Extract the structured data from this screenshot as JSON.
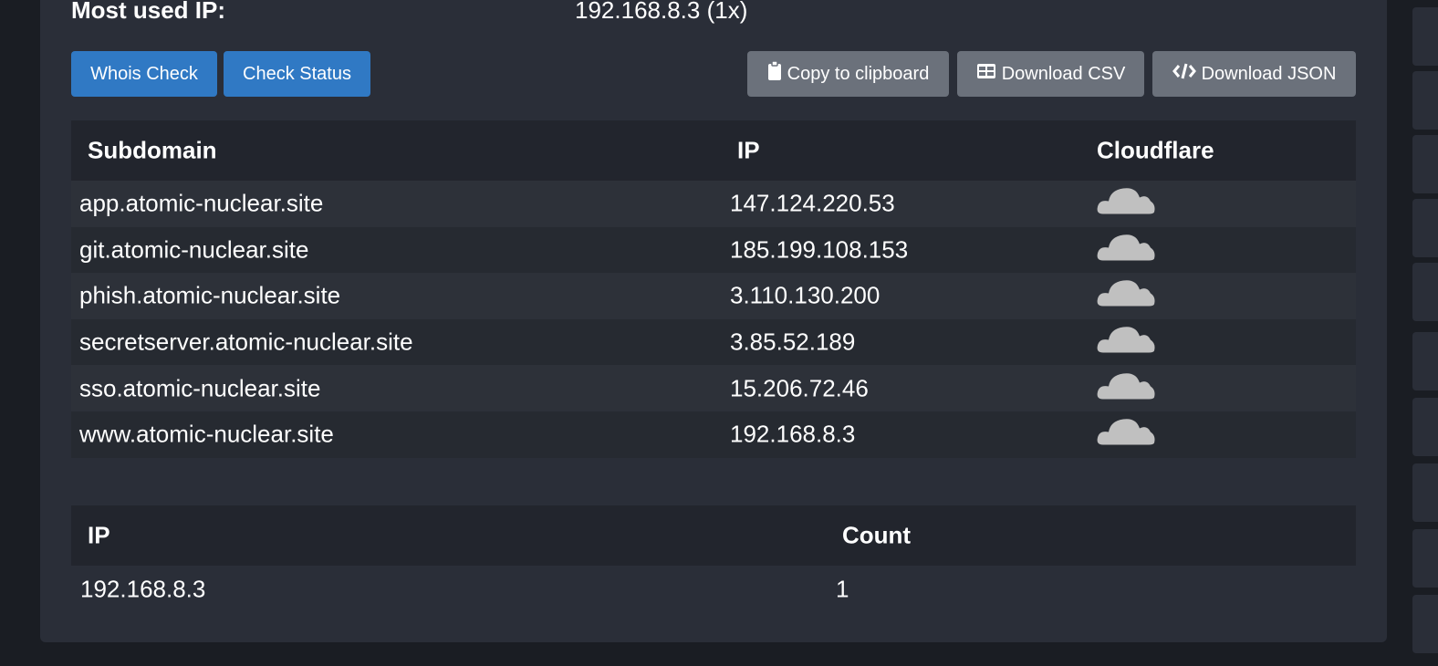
{
  "summary": {
    "label": "Most used IP:",
    "value": "192.168.8.3 (1x)"
  },
  "buttons": {
    "whois": "Whois Check",
    "status": "Check Status",
    "copy": "Copy to clipboard",
    "csv": "Download CSV",
    "json": "Download JSON"
  },
  "subdomain_table": {
    "headers": [
      "Subdomain",
      "IP",
      "Cloudflare"
    ],
    "rows": [
      {
        "subdomain": "app.atomic-nuclear.site",
        "ip": "147.124.220.53"
      },
      {
        "subdomain": "git.atomic-nuclear.site",
        "ip": "185.199.108.153"
      },
      {
        "subdomain": "phish.atomic-nuclear.site",
        "ip": "3.110.130.200"
      },
      {
        "subdomain": "secretserver.atomic-nuclear.site",
        "ip": "3.85.52.189"
      },
      {
        "subdomain": "sso.atomic-nuclear.site",
        "ip": "15.206.72.46"
      },
      {
        "subdomain": "www.atomic-nuclear.site",
        "ip": "192.168.8.3"
      }
    ],
    "cloud_icon": "cloud-icon",
    "cloud_color": "#c0c0c0"
  },
  "ip_count_table": {
    "headers": [
      "IP",
      "Count"
    ],
    "rows": [
      {
        "ip": "192.168.8.3",
        "count": "1"
      }
    ]
  },
  "colors": {
    "primary_button": "#3079c4",
    "secondary_button": "#6b717b",
    "panel": "#2a2e38",
    "background": "#1a1d23"
  }
}
